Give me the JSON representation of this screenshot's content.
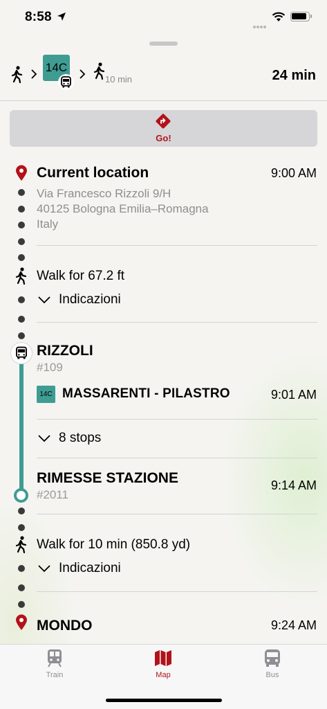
{
  "status_bar": {
    "time": "8:58"
  },
  "summary": {
    "route_badge": "14C",
    "walk_end_min": "10 min",
    "total": "24 min"
  },
  "go_button": {
    "label": "Go!"
  },
  "timeline": {
    "start": {
      "title": "Current location",
      "time": "9:00 AM",
      "address_line1": "Via Francesco Rizzoli 9/H",
      "address_line2": "40125 Bologna Emilia–Romagna",
      "address_line3": "Italy"
    },
    "walk1": {
      "text": "Walk for 67.2 ft",
      "directions": "Indicazioni"
    },
    "board": {
      "stop": "RIZZOLI",
      "stop_code": "#109",
      "route_badge": "14C",
      "route_name": "MASSARENTI - PILASTRO",
      "time": "9:01 AM",
      "stops": "8 stops"
    },
    "alight": {
      "stop": "RIMESSE STAZIONE",
      "stop_code": "#2011",
      "time": "9:14 AM"
    },
    "walk2": {
      "text": "Walk for 10 min (850.8 yd)",
      "directions": "Indicazioni"
    },
    "destination": {
      "title": "MONDO",
      "time": "9:24 AM"
    }
  },
  "tabbar": {
    "items": [
      {
        "label": "Train",
        "active": false
      },
      {
        "label": "Map",
        "active": true
      },
      {
        "label": "Bus",
        "active": false
      }
    ]
  },
  "colors": {
    "accent": "#b2121a",
    "route": "#3f9c93",
    "inactive": "#8e8e93"
  },
  "icons": [
    "location-arrow-icon",
    "wifi-icon",
    "battery-icon",
    "walk-icon",
    "chevron-right-icon",
    "bus-icon",
    "directions-icon",
    "pin-icon",
    "chevron-down-icon",
    "train-icon",
    "map-icon"
  ]
}
